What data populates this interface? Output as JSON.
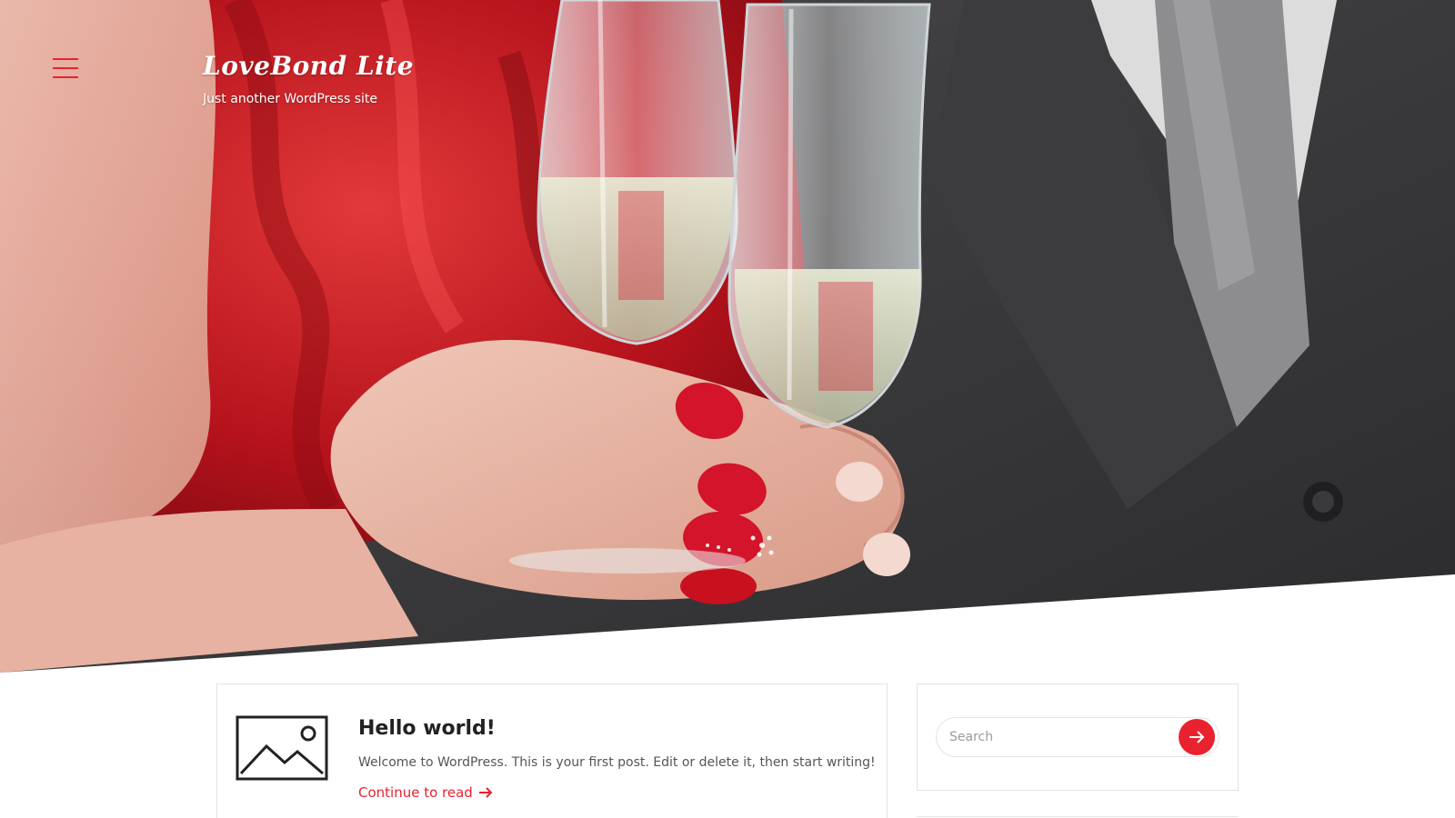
{
  "header": {
    "site_title": "LoveBond Lite",
    "site_description": "Just another WordPress site",
    "menu_icon": "hamburger-icon"
  },
  "colors": {
    "accent": "#e8232f",
    "text_dark": "#222222",
    "text_muted": "#555555",
    "border": "#e4e4e4"
  },
  "post": {
    "title": "Hello world!",
    "excerpt": "Welcome to WordPress. This is your first post. Edit or delete it, then start writing!",
    "read_more": "Continue to read",
    "thumbnail_icon": "image-placeholder-icon"
  },
  "sidebar": {
    "search_placeholder": "Search",
    "search_button_icon": "arrow-right-icon"
  }
}
